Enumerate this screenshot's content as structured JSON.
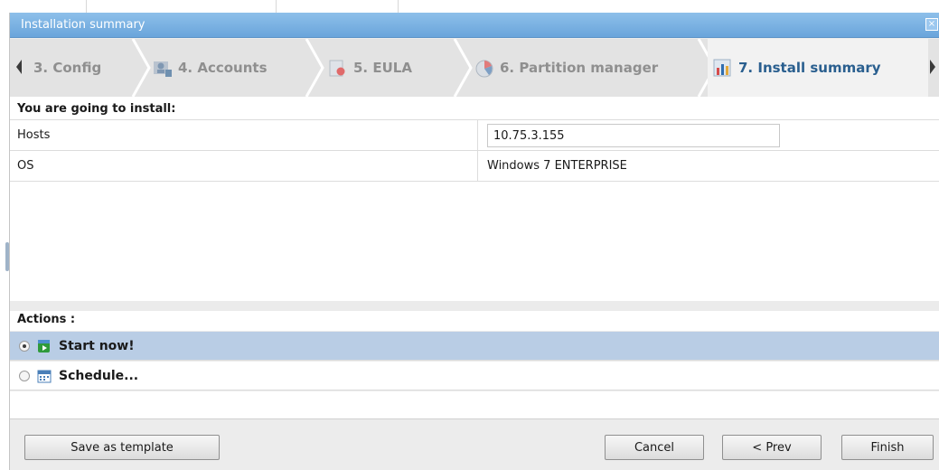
{
  "dialog": {
    "title": "Installation summary",
    "close_glyph": "×"
  },
  "wizard": {
    "steps": [
      {
        "label": "3. Config",
        "icon": "config-icon",
        "active": false
      },
      {
        "label": "4. Accounts",
        "icon": "accounts-icon",
        "active": false
      },
      {
        "label": "5. EULA",
        "icon": "eula-icon",
        "active": false
      },
      {
        "label": "6. Partition manager",
        "icon": "partition-icon",
        "active": false
      },
      {
        "label": "7. Install summary",
        "icon": "summary-chart-icon",
        "active": true
      }
    ]
  },
  "summary": {
    "heading": "You are going to install:",
    "rows": [
      {
        "key": "Hosts",
        "value": "10.75.3.155"
      },
      {
        "key": "OS",
        "value": "Windows 7 ENTERPRISE"
      }
    ]
  },
  "actions": {
    "heading": "Actions :",
    "items": [
      {
        "label": "Start now!",
        "icon": "start-now-icon",
        "selected": true
      },
      {
        "label": "Schedule...",
        "icon": "calendar-icon",
        "selected": false
      }
    ]
  },
  "footer": {
    "save_template": "Save as template",
    "cancel": "Cancel",
    "prev": "< Prev",
    "finish": "Finish"
  },
  "colors": {
    "titlebar": "#6aa5db",
    "selected_row": "#b9cde5",
    "active_step_text": "#2a5f8f"
  }
}
